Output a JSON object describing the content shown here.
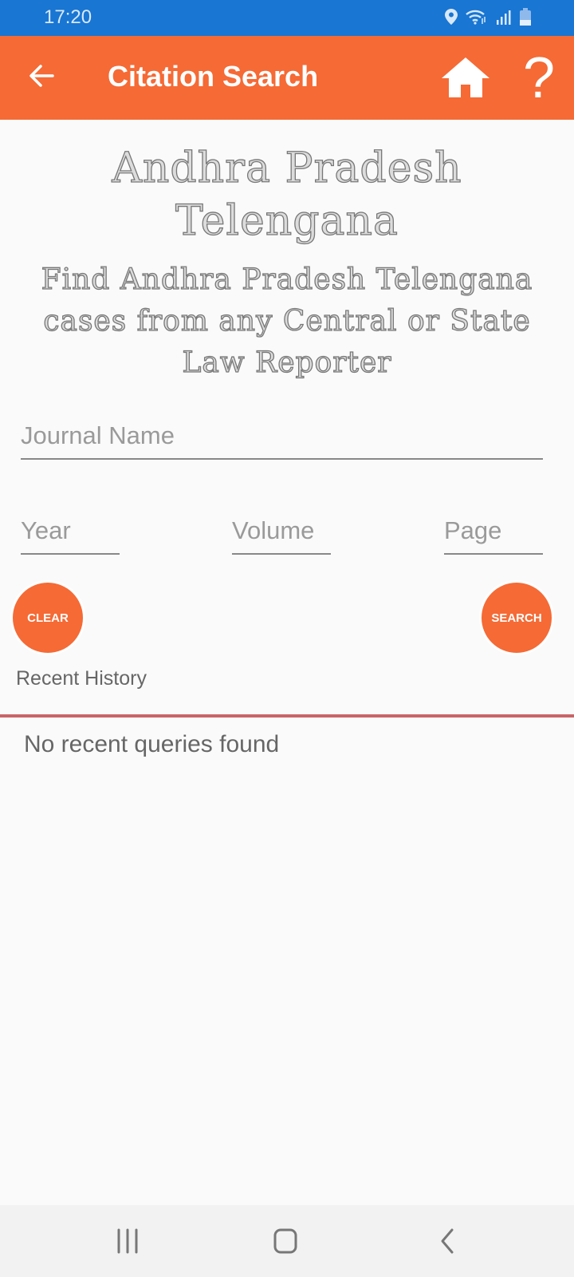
{
  "status_bar": {
    "time": "17:20",
    "icons": [
      "location-icon",
      "wifi-icon",
      "signal-icon",
      "battery-icon"
    ]
  },
  "app_bar": {
    "title": "Citation Search",
    "back_icon": "arrow-left-icon",
    "home_icon": "home-icon",
    "help_label": "?"
  },
  "banner": {
    "title": "Andhra Pradesh Telengana",
    "subtitle": "Find Andhra Pradesh Telengana cases from any Central or State Law Reporter"
  },
  "form": {
    "journal_placeholder": "Journal Name",
    "year_placeholder": "Year",
    "volume_placeholder": "Volume",
    "page_placeholder": "Page",
    "clear_label": "CLEAR",
    "search_label": "SEARCH"
  },
  "history": {
    "heading": "Recent History",
    "empty_message": "No recent queries found"
  },
  "nav_bar": {
    "buttons": [
      "recents-icon",
      "home-icon",
      "back-icon"
    ]
  },
  "colors": {
    "status_bar": "#1976d2",
    "accent": "#f56a35",
    "divider": "#c96468"
  }
}
